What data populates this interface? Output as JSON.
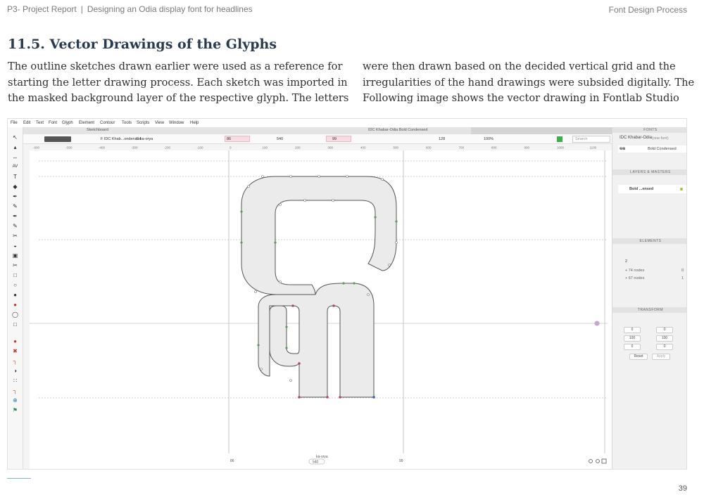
{
  "header": {
    "left_project": "P3- Project Report",
    "left_separator": "|",
    "left_subtitle": "Designing an Odia display font for headlines",
    "right": "Font Design Process"
  },
  "section_title": "11.5. Vector Drawings of the Glyphs",
  "body": {
    "col1": [
      "The outline sketches drawn earlier were used as a reference for",
      "starting the letter drawing process. Each sketch was imported in",
      "the masked background layer of the respective glyph. The letters"
    ],
    "col2": [
      "were then drawn based on the decided vertical grid and the",
      "irregularities of the hand drawings were subsided digitally. The",
      "Following image shows the vector drawing in Fontlab Studio"
    ]
  },
  "app": {
    "menu": [
      "File",
      "Edit",
      "Text",
      "Font",
      "Glyph",
      "Element",
      "Contour",
      "Tools",
      "Scripts",
      "View",
      "Window",
      "Help"
    ],
    "tabs": {
      "sketchboard": "Sketchboard",
      "font_tab": "IDC Khabar-Odia Bold Condensed"
    },
    "toolbar": {
      "font_label": "F IDC Khab...ondensed",
      "glyph_label": "G ka-orya",
      "lsb": "86",
      "advance": "540",
      "rsb": "99",
      "zoom_value": "128",
      "zoom_percent": "100%",
      "search_placeholder": "Search"
    },
    "ruler_ticks": [
      "-600",
      "-500",
      "-400",
      "-300",
      "-200",
      "-100",
      "0",
      "100",
      "200",
      "300",
      "400",
      "500",
      "600",
      "700",
      "800",
      "900",
      "1000",
      "1100"
    ],
    "metrics_bottom": {
      "left": "86",
      "glyph_name": "ka-orya",
      "width": "540",
      "right": "99"
    },
    "panel": {
      "fonts_title": "FONTS",
      "font_family": "IDC Khabar-Odia",
      "font_count": "(one font)",
      "font_style": "Bold Condensed",
      "layers_title": "LAYERS & MASTERS",
      "layer_name": "Bold ...ensed",
      "elements_title": "ELEMENTS",
      "element_count": "2",
      "element1_nodes": "+ 74 nodes",
      "element1_count": "0",
      "element2_nodes": "+ 67 nodes",
      "element2_count": "1",
      "transform_title": "TRANSFORM",
      "tx": "0",
      "ty": "0",
      "sx": "100",
      "sy": "100",
      "rot": "0",
      "slant": "0",
      "reset": "Reset",
      "apply": "Apply"
    }
  },
  "page_number": "39"
}
